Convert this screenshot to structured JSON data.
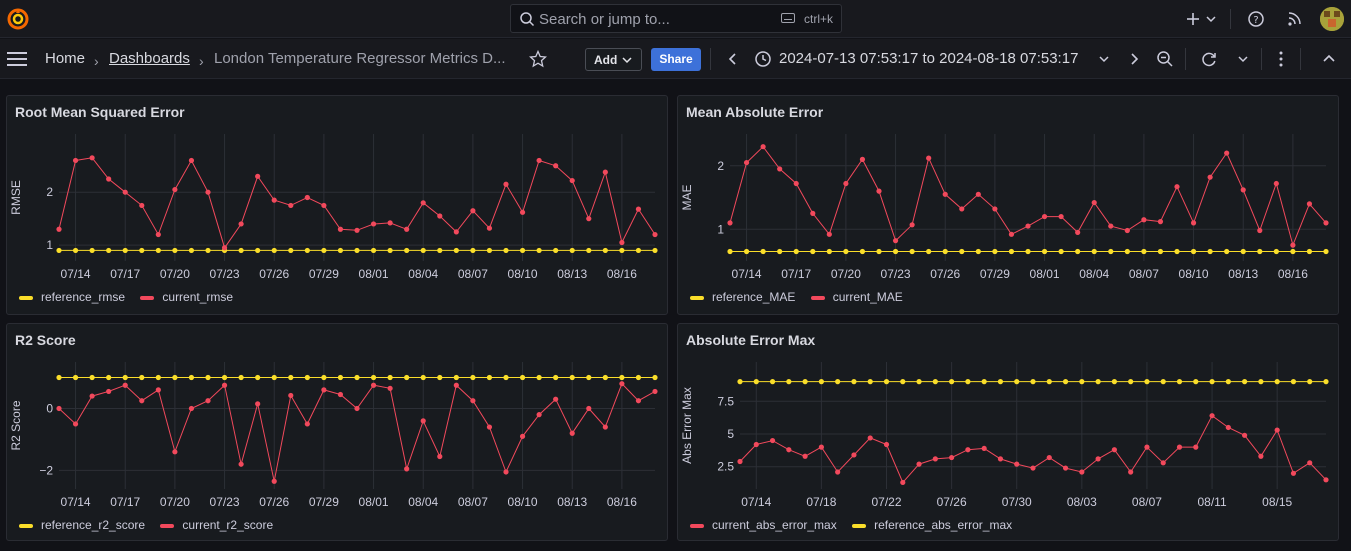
{
  "topbar": {
    "search_placeholder": "Search or jump to...",
    "search_shortcut": "ctrl+k",
    "icons": [
      "grafana-logo-icon",
      "search-icon",
      "keyboard-icon",
      "plus-icon",
      "chevron-down-icon",
      "help-icon",
      "rss-icon",
      "avatar"
    ]
  },
  "navbar": {
    "breadcrumb": [
      "Home",
      "Dashboards",
      "London Temperature Regressor Metrics D..."
    ],
    "add_label": "Add",
    "share_label": "Share",
    "time_range": "2024-07-13 07:53:17 to 2024-08-18 07:53:17"
  },
  "colors": {
    "reference": "#fade2a",
    "current": "#f2495c",
    "accent": "#3d71d9",
    "grid": "#2c2f36"
  },
  "chart_data": [
    {
      "type": "line",
      "title": "Root Mean Squared Error",
      "ylabel": "RMSE",
      "ylim": [
        0.7,
        3.1
      ],
      "yticks": [
        1,
        2
      ],
      "ytick_labels": [
        "1",
        "2"
      ],
      "x_start": "2024-07-13",
      "xtick_labels": [
        "07/14",
        "07/17",
        "07/20",
        "07/23",
        "07/26",
        "07/29",
        "08/01",
        "08/04",
        "08/07",
        "08/10",
        "08/13",
        "08/16"
      ],
      "xtick_days": [
        1,
        4,
        7,
        10,
        13,
        16,
        19,
        22,
        25,
        28,
        31,
        34
      ],
      "days": [
        0,
        1,
        2,
        3,
        4,
        5,
        6,
        7,
        8,
        9,
        10,
        11,
        12,
        13,
        14,
        15,
        16,
        17,
        18,
        19,
        20,
        21,
        22,
        23,
        24,
        25,
        26,
        27,
        28,
        29,
        30,
        31,
        32,
        33,
        34,
        35,
        36
      ],
      "series": [
        {
          "name": "reference_rmse",
          "color": "#fade2a",
          "values": [
            0.9,
            0.9,
            0.9,
            0.9,
            0.9,
            0.9,
            0.9,
            0.9,
            0.9,
            0.9,
            0.9,
            0.9,
            0.9,
            0.9,
            0.9,
            0.9,
            0.9,
            0.9,
            0.9,
            0.9,
            0.9,
            0.9,
            0.9,
            0.9,
            0.9,
            0.9,
            0.9,
            0.9,
            0.9,
            0.9,
            0.9,
            0.9,
            0.9,
            0.9,
            0.9,
            0.9,
            0.9
          ]
        },
        {
          "name": "current_rmse",
          "color": "#f2495c",
          "values": [
            1.3,
            2.6,
            2.65,
            2.25,
            2.0,
            1.75,
            1.2,
            2.05,
            2.6,
            2.0,
            0.95,
            1.4,
            2.3,
            1.85,
            1.75,
            1.9,
            1.75,
            1.3,
            1.28,
            1.4,
            1.42,
            1.3,
            1.8,
            1.55,
            1.25,
            1.65,
            1.32,
            2.15,
            1.62,
            2.6,
            2.5,
            2.22,
            1.5,
            2.38,
            1.05,
            1.68,
            1.2
          ]
        }
      ],
      "legend": [
        "reference_rmse",
        "current_rmse"
      ]
    },
    {
      "type": "line",
      "title": "Mean Absolute Error",
      "ylabel": "MAE",
      "ylim": [
        0.5,
        2.5
      ],
      "yticks": [
        1,
        2
      ],
      "ytick_labels": [
        "1",
        "2"
      ],
      "x_start": "2024-07-13",
      "xtick_labels": [
        "07/14",
        "07/17",
        "07/20",
        "07/23",
        "07/26",
        "07/29",
        "08/01",
        "08/04",
        "08/07",
        "08/10",
        "08/13",
        "08/16"
      ],
      "xtick_days": [
        1,
        4,
        7,
        10,
        13,
        16,
        19,
        22,
        25,
        28,
        31,
        34
      ],
      "days": [
        0,
        1,
        2,
        3,
        4,
        5,
        6,
        7,
        8,
        9,
        10,
        11,
        12,
        13,
        14,
        15,
        16,
        17,
        18,
        19,
        20,
        21,
        22,
        23,
        24,
        25,
        26,
        27,
        28,
        29,
        30,
        31,
        32,
        33,
        34,
        35,
        36
      ],
      "series": [
        {
          "name": "reference_MAE",
          "color": "#fade2a",
          "values": [
            0.65,
            0.65,
            0.65,
            0.65,
            0.65,
            0.65,
            0.65,
            0.65,
            0.65,
            0.65,
            0.65,
            0.65,
            0.65,
            0.65,
            0.65,
            0.65,
            0.65,
            0.65,
            0.65,
            0.65,
            0.65,
            0.65,
            0.65,
            0.65,
            0.65,
            0.65,
            0.65,
            0.65,
            0.65,
            0.65,
            0.65,
            0.65,
            0.65,
            0.65,
            0.65,
            0.65,
            0.65
          ]
        },
        {
          "name": "current_MAE",
          "color": "#f2495c",
          "values": [
            1.1,
            2.05,
            2.3,
            1.95,
            1.72,
            1.25,
            0.92,
            1.72,
            2.1,
            1.6,
            0.82,
            1.07,
            2.12,
            1.55,
            1.32,
            1.55,
            1.32,
            0.92,
            1.05,
            1.2,
            1.2,
            0.95,
            1.42,
            1.05,
            0.98,
            1.15,
            1.12,
            1.67,
            1.1,
            1.82,
            2.2,
            1.62,
            0.98,
            1.72,
            0.75,
            1.4,
            1.1
          ]
        }
      ],
      "legend": [
        "reference_MAE",
        "current_MAE"
      ]
    },
    {
      "type": "line",
      "title": "R2 Score",
      "ylabel": "R2 Score",
      "ylim": [
        -2.6,
        1.5
      ],
      "yticks": [
        0,
        -2
      ],
      "ytick_labels": [
        "0",
        "−2"
      ],
      "x_start": "2024-07-13",
      "xtick_labels": [
        "07/14",
        "07/17",
        "07/20",
        "07/23",
        "07/26",
        "07/29",
        "08/01",
        "08/04",
        "08/07",
        "08/10",
        "08/13",
        "08/16"
      ],
      "xtick_days": [
        1,
        4,
        7,
        10,
        13,
        16,
        19,
        22,
        25,
        28,
        31,
        34
      ],
      "days": [
        0,
        1,
        2,
        3,
        4,
        5,
        6,
        7,
        8,
        9,
        10,
        11,
        12,
        13,
        14,
        15,
        16,
        17,
        18,
        19,
        20,
        21,
        22,
        23,
        24,
        25,
        26,
        27,
        28,
        29,
        30,
        31,
        32,
        33,
        34,
        35,
        36
      ],
      "series": [
        {
          "name": "reference_r2_score",
          "color": "#fade2a",
          "values": [
            1,
            1,
            1,
            1,
            1,
            1,
            1,
            1,
            1,
            1,
            1,
            1,
            1,
            1,
            1,
            1,
            1,
            1,
            1,
            1,
            1,
            1,
            1,
            1,
            1,
            1,
            1,
            1,
            1,
            1,
            1,
            1,
            1,
            1,
            1,
            1,
            1
          ]
        },
        {
          "name": "current_r2_score",
          "color": "#f2495c",
          "values": [
            0.0,
            -0.5,
            0.4,
            0.55,
            0.75,
            0.25,
            0.6,
            -1.4,
            0.0,
            0.25,
            0.75,
            -1.8,
            0.15,
            -2.35,
            0.42,
            -0.5,
            0.6,
            0.45,
            0.0,
            0.75,
            0.65,
            -1.95,
            -0.4,
            -1.55,
            0.75,
            0.25,
            -0.6,
            -2.05,
            -0.9,
            -0.2,
            0.3,
            -0.8,
            0.0,
            -0.6,
            0.8,
            0.25,
            0.55
          ]
        }
      ],
      "legend": [
        "reference_r2_score",
        "current_r2_score"
      ]
    },
    {
      "type": "line",
      "title": "Absolute Error Max",
      "ylabel": "Abs Error Max",
      "ylim": [
        0.8,
        10.5
      ],
      "yticks": [
        2.5,
        5,
        7.5
      ],
      "ytick_labels": [
        "2.5",
        "5",
        "7.5"
      ],
      "x_start": "2024-07-13",
      "xtick_labels": [
        "07/14",
        "07/18",
        "07/22",
        "07/26",
        "07/30",
        "08/03",
        "08/07",
        "08/11",
        "08/15"
      ],
      "xtick_days": [
        1,
        5,
        9,
        13,
        17,
        21,
        25,
        29,
        33
      ],
      "days": [
        0,
        1,
        2,
        3,
        4,
        5,
        6,
        7,
        8,
        9,
        10,
        11,
        12,
        13,
        14,
        15,
        16,
        17,
        18,
        19,
        20,
        21,
        22,
        23,
        24,
        25,
        26,
        27,
        28,
        29,
        30,
        31,
        32,
        33,
        34,
        35,
        36
      ],
      "series": [
        {
          "name": "current_abs_error_max",
          "color": "#f2495c",
          "values": [
            2.9,
            4.2,
            4.5,
            3.8,
            3.3,
            4.0,
            2.1,
            3.4,
            4.7,
            4.2,
            1.3,
            2.7,
            3.1,
            3.2,
            3.8,
            3.9,
            3.1,
            2.7,
            2.4,
            3.2,
            2.4,
            2.1,
            3.1,
            3.8,
            2.1,
            4.0,
            2.8,
            4.0,
            4.0,
            6.4,
            5.5,
            4.9,
            3.3,
            5.3,
            2.0,
            2.8,
            1.5
          ]
        },
        {
          "name": "reference_abs_error_max",
          "color": "#fade2a",
          "values": [
            9.0,
            9.0,
            9.0,
            9.0,
            9.0,
            9.0,
            9.0,
            9.0,
            9.0,
            9.0,
            9.0,
            9.0,
            9.0,
            9.0,
            9.0,
            9.0,
            9.0,
            9.0,
            9.0,
            9.0,
            9.0,
            9.0,
            9.0,
            9.0,
            9.0,
            9.0,
            9.0,
            9.0,
            9.0,
            9.0,
            9.0,
            9.0,
            9.0,
            9.0,
            9.0,
            9.0,
            9.0
          ]
        }
      ],
      "legend": [
        "current_abs_error_max",
        "reference_abs_error_max"
      ]
    }
  ]
}
